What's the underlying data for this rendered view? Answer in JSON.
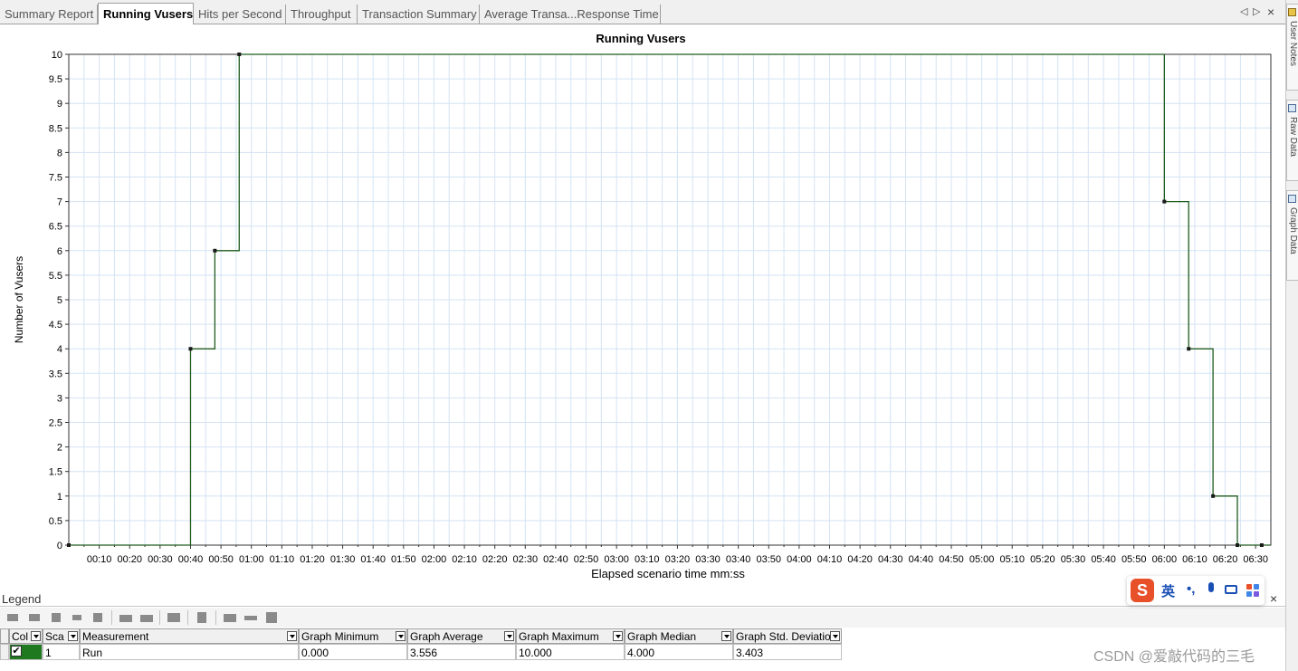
{
  "tabs": [
    {
      "label": "Summary Report",
      "active": false
    },
    {
      "label": "Running Vusers",
      "active": true
    },
    {
      "label": "Hits per Second",
      "active": false
    },
    {
      "label": "Throughput",
      "active": false
    },
    {
      "label": "Transaction Summary",
      "active": false
    },
    {
      "label": "Average Transa...Response Time",
      "active": false
    }
  ],
  "side_tabs": [
    "User Notes",
    "Raw Data",
    "Graph Data"
  ],
  "colors": {
    "line": "#1f5c1f",
    "grid": "#d4e3f3",
    "color_cell": "#1f7a1f"
  },
  "chart_data": {
    "type": "line",
    "title": "Running Vusers",
    "xlabel": "Elapsed scenario time mm:ss",
    "ylabel": "Number of Vusers",
    "step": true,
    "xlim": [
      0,
      395
    ],
    "ylim": [
      0,
      10
    ],
    "y_ticks": [
      "0",
      "0.5",
      "1",
      "1.5",
      "2",
      "2.5",
      "3",
      "3.5",
      "4",
      "4.5",
      "5",
      "5.5",
      "6",
      "6.5",
      "7",
      "7.5",
      "8",
      "8.5",
      "9",
      "9.5",
      "10"
    ],
    "x_ticks": [
      "00:10",
      "00:20",
      "00:30",
      "00:40",
      "00:50",
      "01:00",
      "01:10",
      "01:20",
      "01:30",
      "01:40",
      "01:50",
      "02:00",
      "02:10",
      "02:20",
      "02:30",
      "02:40",
      "02:50",
      "03:00",
      "03:10",
      "03:20",
      "03:30",
      "03:40",
      "03:50",
      "04:00",
      "04:10",
      "04:20",
      "04:30",
      "04:40",
      "04:50",
      "05:00",
      "05:10",
      "05:20",
      "05:30",
      "05:40",
      "05:50",
      "06:00",
      "06:10",
      "06:20",
      "06:30"
    ],
    "grid": true,
    "series": [
      {
        "name": "Run",
        "x": [
          0,
          40,
          48,
          56,
          360,
          368,
          376,
          384,
          392
        ],
        "y": [
          0,
          4,
          6,
          10,
          7,
          4,
          1,
          0,
          0
        ]
      }
    ]
  },
  "legend": {
    "title": "Legend",
    "close": "×",
    "columns": [
      "Col",
      "Sca",
      "Measurement",
      "Graph Minimum",
      "Graph Average",
      "Graph Maximum",
      "Graph Median",
      "Graph Std. Deviation"
    ],
    "rows": [
      {
        "checked": "✔",
        "scale": "1",
        "measurement": "Run",
        "min": "0.000",
        "avg": "3.556",
        "max": "10.000",
        "median": "4.000",
        "std": "3.403"
      }
    ]
  },
  "ime": {
    "logo": "S",
    "lang": "英",
    "punct": "•,"
  },
  "watermark": "CSDN @爱敲代码的三毛"
}
